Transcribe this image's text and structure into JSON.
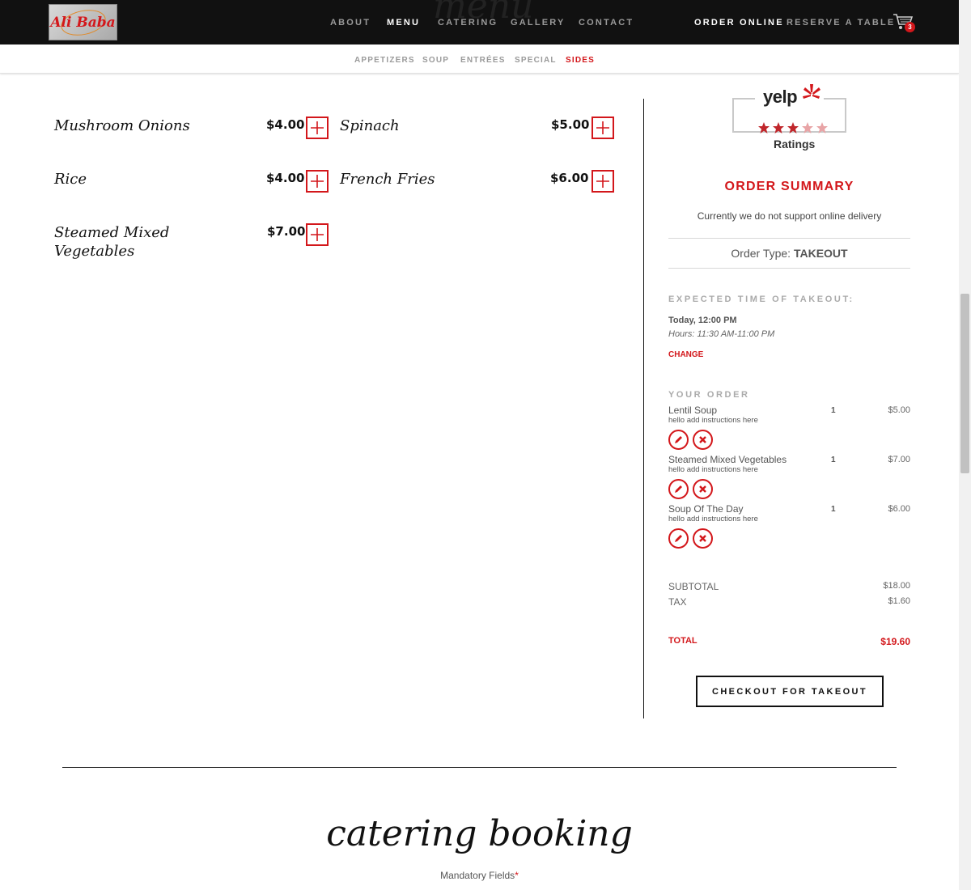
{
  "brand": {
    "logo_text": "Ali Baba"
  },
  "hidden_heading": "menu",
  "nav": {
    "about": "ABOUT",
    "menu": "MENU",
    "catering": "CATERING",
    "gallery": "GALLERY",
    "contact": "CONTACT",
    "order_online": "ORDER ONLINE",
    "reserve": "RESERVE A TABLE",
    "cart_count": "3"
  },
  "subnav": {
    "appetizers": "APPETIZERS",
    "soup": "SOUP",
    "entrees": "ENTRÉES",
    "special": "SPECIAL",
    "sides": "SIDES"
  },
  "menu_items": [
    {
      "name": "Mushroom Onions",
      "price": "$4.00"
    },
    {
      "name": "Spinach",
      "price": "$5.00"
    },
    {
      "name": "Rice",
      "price": "$4.00"
    },
    {
      "name": "French Fries",
      "price": "$6.00"
    },
    {
      "name": "Steamed Mixed Vegetables",
      "price": "$7.00"
    }
  ],
  "yelp": {
    "word": "yelp",
    "rating_stars": 3,
    "max_stars": 5,
    "label": "Ratings"
  },
  "summary": {
    "title": "ORDER SUMMARY",
    "note": "Currently we do not support online delivery",
    "order_type_label": "Order Type:",
    "order_type_value": "TAKEOUT",
    "expected_heading": "EXPECTED TIME OF TAKEOUT:",
    "time": "Today, 12:00 PM",
    "hours": "Hours: 11:30 AM-11:00 PM",
    "change": "CHANGE",
    "your_order": "YOUR ORDER",
    "items": [
      {
        "name": "Lentil Soup",
        "note": "hello add instructions here",
        "qty": "1",
        "price": "$5.00"
      },
      {
        "name": "Steamed Mixed Vegetables",
        "note": "hello add instructions here",
        "qty": "1",
        "price": "$7.00"
      },
      {
        "name": "Soup Of The Day",
        "note": "hello add instructions here",
        "qty": "1",
        "price": "$6.00"
      }
    ],
    "subtotal_label": "SUBTOTAL",
    "subtotal": "$18.00",
    "tax_label": "TAX",
    "tax": "$1.60",
    "total_label": "TOTAL",
    "total": "$19.60",
    "checkout": "CHECKOUT FOR TAKEOUT"
  },
  "catering": {
    "title": "catering booking",
    "mandatory": "Mandatory Fields",
    "required_mark": "*"
  },
  "colors": {
    "accent": "#d3171b",
    "nav_bg": "#111111"
  }
}
